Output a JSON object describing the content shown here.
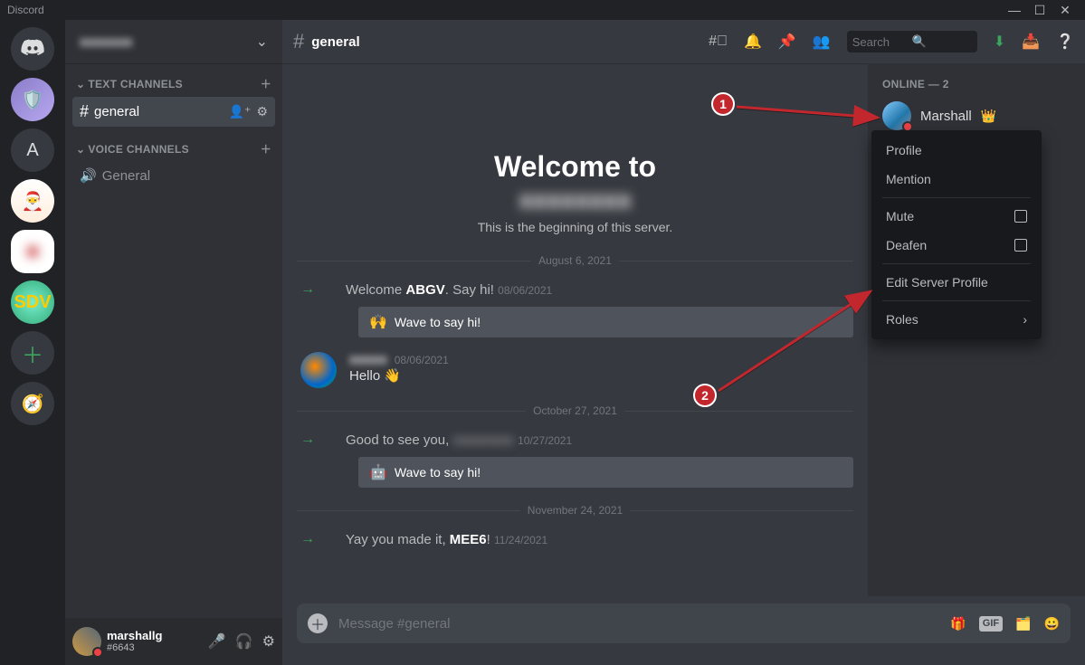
{
  "app_title": "Discord",
  "sidebar": {
    "text_ch_header": "TEXT CHANNELS",
    "voice_ch_header": "VOICE CHANNELS",
    "text_channels": [
      {
        "name": "general",
        "active": true
      }
    ],
    "voice_channels": [
      {
        "name": "General"
      }
    ]
  },
  "user_panel": {
    "username": "marshallg",
    "discriminator": "#6643"
  },
  "header": {
    "channel": "general",
    "search_placeholder": "Search"
  },
  "welcome": {
    "title": "Welcome to",
    "beginning": "This is the beginning of this server."
  },
  "dividers": [
    "August 6, 2021",
    "October 27, 2021",
    "November 24, 2021"
  ],
  "messages": {
    "m1_pre": "Welcome ",
    "m1_bold": "ABGV",
    "m1_post": ". Say hi!",
    "m1_ts": "08/06/2021",
    "wave_label": "Wave to say hi!",
    "m2_text": "Hello ",
    "m2_emoji": "👋",
    "m2_ts": "08/06/2021",
    "m3_pre": "Good to see you,",
    "m3_ts": "10/27/2021",
    "m4_pre": "Yay you made it, ",
    "m4_bold": "MEE6",
    "m4_post": "!",
    "m4_ts": "11/24/2021"
  },
  "composer": {
    "placeholder": "Message #general",
    "gif": "GIF"
  },
  "members": {
    "header": "ONLINE — 2",
    "name": "Marshall"
  },
  "ctx": {
    "profile": "Profile",
    "mention": "Mention",
    "mute": "Mute",
    "deafen": "Deafen",
    "edit": "Edit Server Profile",
    "roles": "Roles"
  },
  "ann": {
    "one": "1",
    "two": "2"
  }
}
